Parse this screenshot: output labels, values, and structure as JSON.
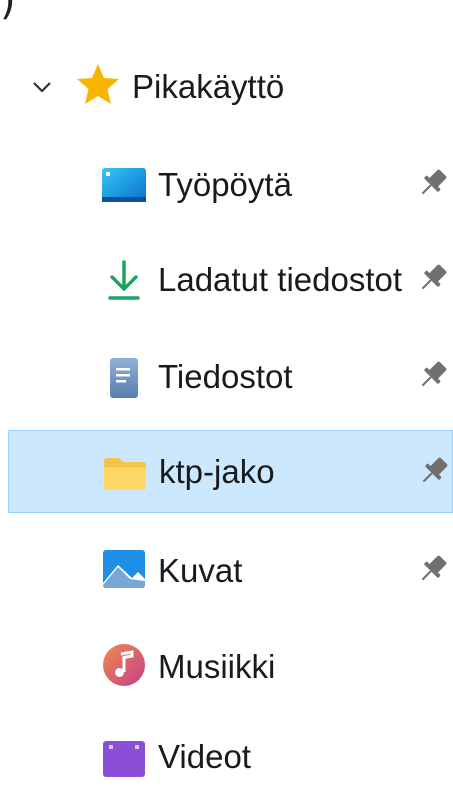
{
  "header": {
    "partial_glyph": ")"
  },
  "quick_access": {
    "label": "Pikakäyttö",
    "expanded": true
  },
  "items": [
    {
      "label": "Työpöytä",
      "icon": "desktop-icon",
      "pinned": true,
      "selected": false
    },
    {
      "label": "Ladatut tiedostot",
      "icon": "download-icon",
      "pinned": true,
      "selected": false
    },
    {
      "label": "Tiedostot",
      "icon": "documents-icon",
      "pinned": true,
      "selected": false
    },
    {
      "label": "ktp-jako",
      "icon": "folder-icon",
      "pinned": true,
      "selected": true
    },
    {
      "label": "Kuvat",
      "icon": "pictures-icon",
      "pinned": true,
      "selected": false
    },
    {
      "label": "Musiikki",
      "icon": "music-icon",
      "pinned": false,
      "selected": false
    },
    {
      "label": "Videot",
      "icon": "videos-icon",
      "pinned": false,
      "selected": false
    }
  ],
  "colors": {
    "selection_bg": "#cce8ff",
    "selection_border": "#99d1ff",
    "star": "#f7b500",
    "download_green": "#1aa260",
    "pin_gray": "#707070"
  }
}
